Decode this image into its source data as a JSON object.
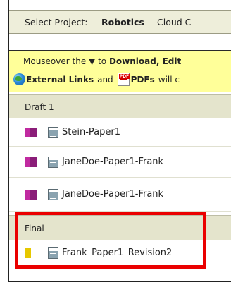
{
  "project_bar": {
    "label": "Select Project:",
    "current_project": "Robotics",
    "next_project": "Cloud C"
  },
  "notice": {
    "line1_prefix": "Mouseover the",
    "line1_arrow": "▼",
    "line1_middle": "to",
    "line1_bold": "Download, Edit",
    "line2_bold1": "External Links",
    "line2_and": "and",
    "line2_bold2": "PDFs",
    "line2_suffix": "will c"
  },
  "groups": [
    {
      "title": "Draft 1",
      "items": [
        {
          "name": "Stein-Paper1",
          "icon": "group-people-icon"
        },
        {
          "name": "JaneDoe-Paper1-Frank",
          "icon": "group-people-icon"
        },
        {
          "name": "JaneDoe-Paper1-Frank",
          "icon": "group-people-icon"
        }
      ]
    },
    {
      "title": "Final",
      "items": [
        {
          "name": "Frank_Paper1_Revision2",
          "icon": "single-person-icon"
        }
      ]
    }
  ],
  "colors": {
    "highlight_border": "#ea0000",
    "notice_bg": "#ffff99",
    "group_header_bg": "#e4e4cc"
  }
}
